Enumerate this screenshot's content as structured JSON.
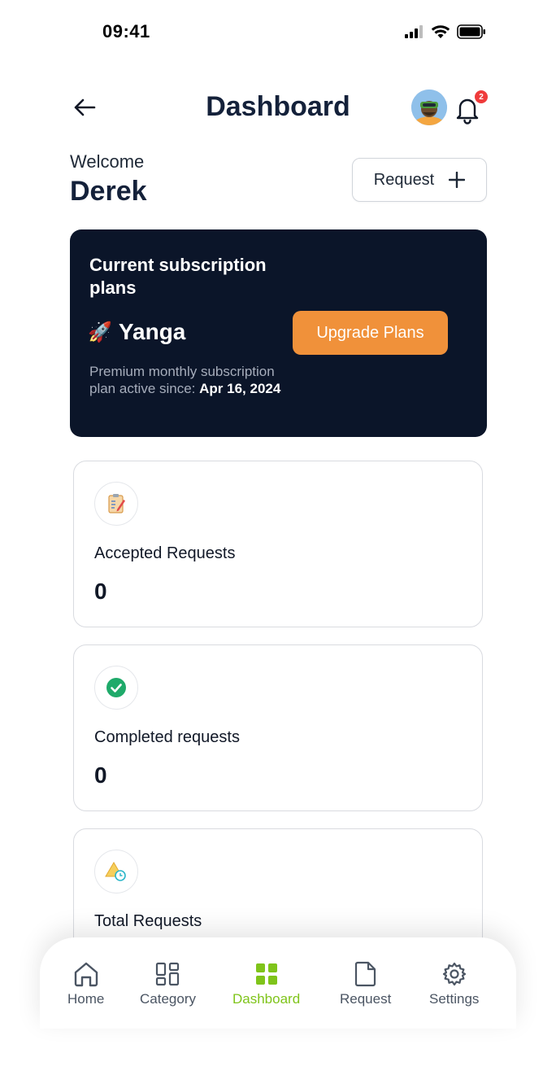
{
  "status_bar": {
    "time": "09:41"
  },
  "header": {
    "title": "Dashboard",
    "notification_count": "2"
  },
  "welcome": {
    "label": "Welcome",
    "name": "Derek",
    "request_button": "Request"
  },
  "subscription": {
    "title": "Current subscription plans",
    "plan_emoji": "🚀",
    "plan_name": "Yanga",
    "description": "Premium monthly subscription plan active since:",
    "since_date": "Apr 16, 2024",
    "upgrade_button": "Upgrade Plans"
  },
  "stats": [
    {
      "label": "Accepted Requests",
      "value": "0",
      "icon": "clipboard-icon"
    },
    {
      "label": "Completed requests",
      "value": "0",
      "icon": "check-circle-icon"
    },
    {
      "label": "Total Requests",
      "value": "",
      "icon": "warning-clock-icon"
    }
  ],
  "nav": {
    "items": [
      {
        "label": "Home",
        "icon": "home-icon"
      },
      {
        "label": "Category",
        "icon": "category-icon"
      },
      {
        "label": "Dashboard",
        "icon": "dashboard-icon"
      },
      {
        "label": "Request",
        "icon": "document-icon"
      },
      {
        "label": "Settings",
        "icon": "gear-icon"
      }
    ],
    "active": "Dashboard"
  },
  "colors": {
    "card_dark": "#0b1529",
    "upgrade_orange": "#f0913a",
    "active_green": "#7fc41a",
    "badge_red": "#ef3b3b"
  }
}
